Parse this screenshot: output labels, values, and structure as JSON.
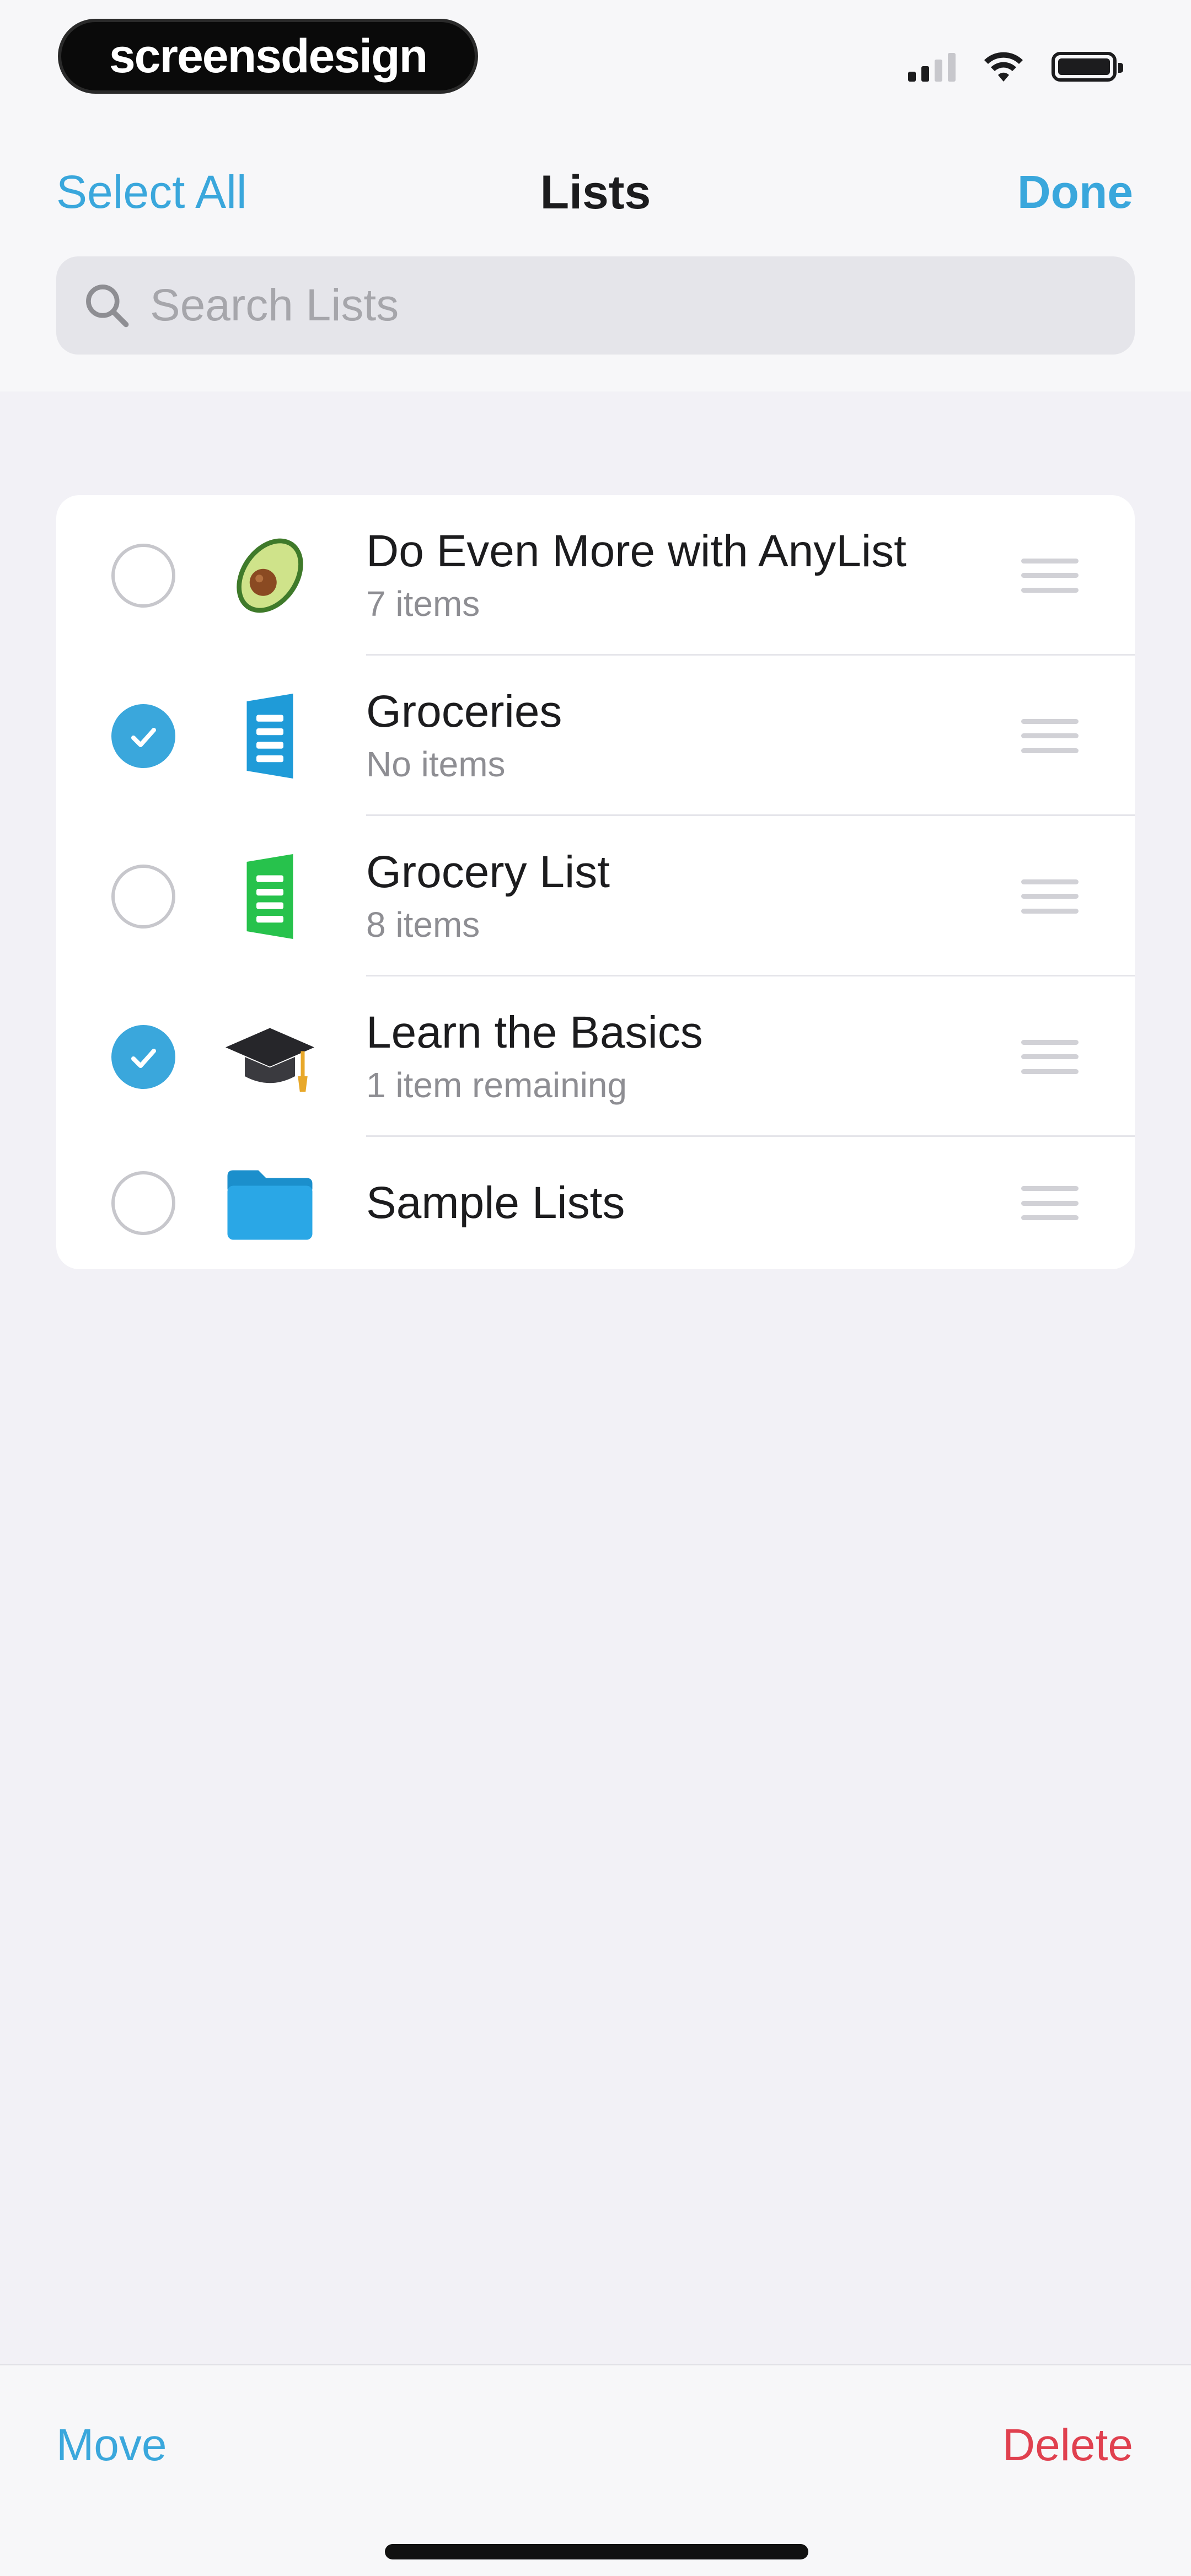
{
  "status_bar": {
    "brand": "screensdesign",
    "icons": [
      "cellular-signal-icon",
      "wifi-icon",
      "battery-icon"
    ]
  },
  "nav": {
    "select_all": "Select All",
    "title": "Lists",
    "done": "Done"
  },
  "search": {
    "placeholder": "Search Lists",
    "icon": "search-icon"
  },
  "lists": [
    {
      "title": "Do Even More with AnyList",
      "subtitle": "7 items",
      "selected": false,
      "icon": "avocado-icon"
    },
    {
      "title": "Groceries",
      "subtitle": "No items",
      "selected": true,
      "icon": "list-blue-icon"
    },
    {
      "title": "Grocery List",
      "subtitle": "8 items",
      "selected": false,
      "icon": "list-green-icon"
    },
    {
      "title": "Learn the Basics",
      "subtitle": "1 item remaining",
      "selected": true,
      "icon": "graduation-cap-icon"
    },
    {
      "title": "Sample Lists",
      "subtitle": "",
      "selected": false,
      "icon": "folder-icon"
    }
  ],
  "toolbar": {
    "move": "Move",
    "delete": "Delete"
  },
  "colors": {
    "accent": "#3aa7dc",
    "destructive": "#e0404f",
    "background": "#f2f1f6",
    "list_green": "#27c24c"
  }
}
